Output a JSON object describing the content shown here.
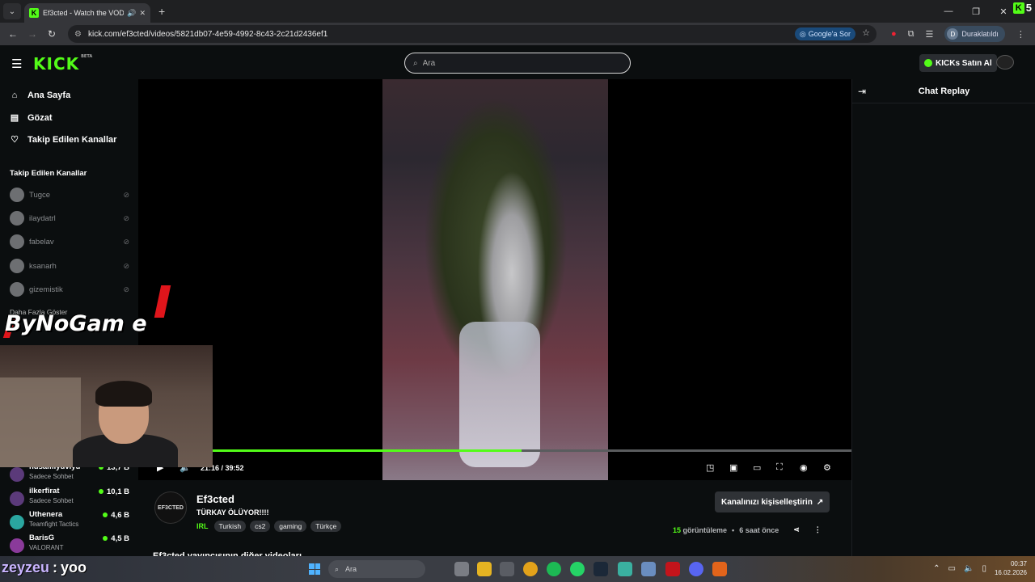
{
  "browser": {
    "tab_title": "Ef3cted - Watch the VOD o",
    "url": "kick.com/ef3cted/videos/5821db07-4e59-4992-8c43-2c21d2436ef1",
    "google_ask": "Google'a Sor",
    "profile_label": "Duraklatıldı",
    "profile_initial": "D",
    "ext_badge": "5"
  },
  "header": {
    "logo": "KICK",
    "logo_sup": "BETA",
    "search_placeholder": "Ara",
    "buy_kicks": "KICKs Satın Al"
  },
  "sidebar": {
    "nav": [
      {
        "label": "Ana Sayfa",
        "icon": "home-icon"
      },
      {
        "label": "Gözat",
        "icon": "browse-icon"
      },
      {
        "label": "Takip Edilen Kanallar",
        "icon": "heart-icon"
      }
    ],
    "followed_title": "Takip Edilen Kanallar",
    "followed": [
      "Tugce",
      "ilaydatrl",
      "fabelav",
      "ksanarh",
      "gizemistik"
    ],
    "show_more": "Daha Fazla Göster",
    "recommended": [
      {
        "name": "hüsamiyüviyü",
        "category": "Sadece Sohbet",
        "viewers": "13,7 B"
      },
      {
        "name": "ilkerfirat",
        "category": "Sadece Sohbet",
        "viewers": "10,1 B"
      },
      {
        "name": "Uthenera",
        "category": "Teamfight Tactics",
        "viewers": "4,6 B"
      },
      {
        "name": "BarisG",
        "category": "VALORANT",
        "viewers": "4,5 B"
      }
    ]
  },
  "player": {
    "current_time": "21:16",
    "duration": "39:52",
    "progress_fraction": 0.483
  },
  "overlay": {
    "brand": "ByNoGam e",
    "chat_user": "zeyzeu",
    "chat_sep": ":",
    "chat_msg": "yoo"
  },
  "chat": {
    "title": "Chat Replay"
  },
  "video_info": {
    "avatar_text": "EF3CTED",
    "channel": "Ef3cted",
    "title": "TÜRKAY ÖLÜYOR!!!!",
    "category": "IRL",
    "tags": [
      "Turkish",
      "cs2",
      "gaming",
      "Türkçe"
    ],
    "customize": "Kanalınızı kişiselleştirin",
    "views_num": "15",
    "views_label": "görüntüleme",
    "age": "6 saat önce",
    "more_videos": "Ef3cted yayıncısının diğer videoları"
  },
  "taskbar": {
    "search_placeholder": "Ara",
    "time": "00:37",
    "date": "16.02.2026"
  }
}
